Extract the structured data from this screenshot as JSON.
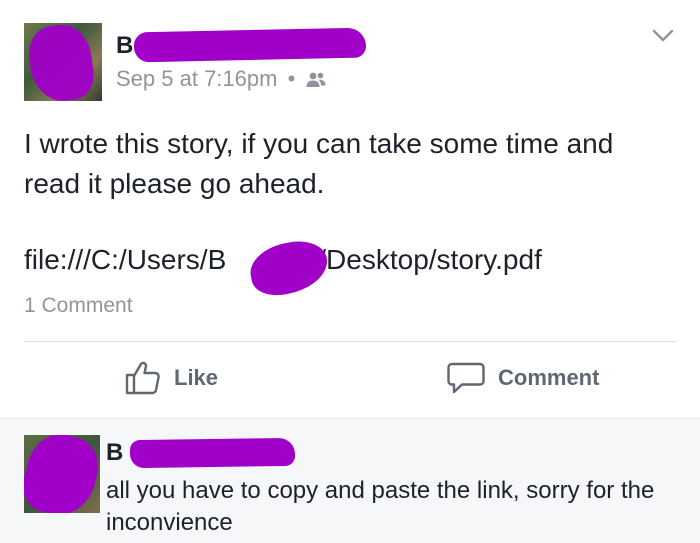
{
  "post": {
    "author_visible": "B",
    "timestamp": "Sep 5 at 7:16pm",
    "separator": "•",
    "audience_icon": "friends-icon",
    "text": "I wrote this story, if you can take some time and read it please go ahead.",
    "link_prefix": "file:///C:/Users/B",
    "link_suffix": "/Desktop/story.pdf",
    "comment_count": "1 Comment"
  },
  "actions": {
    "like_label": "Like",
    "comment_label": "Comment"
  },
  "comment": {
    "author_visible": "B",
    "text": "all you have to copy and paste the link, sorry for the inconvience"
  },
  "colors": {
    "redaction": "#a000c8",
    "meta_gray": "#90949c",
    "action_gray": "#606770",
    "comment_bg": "#f6f7f9"
  }
}
